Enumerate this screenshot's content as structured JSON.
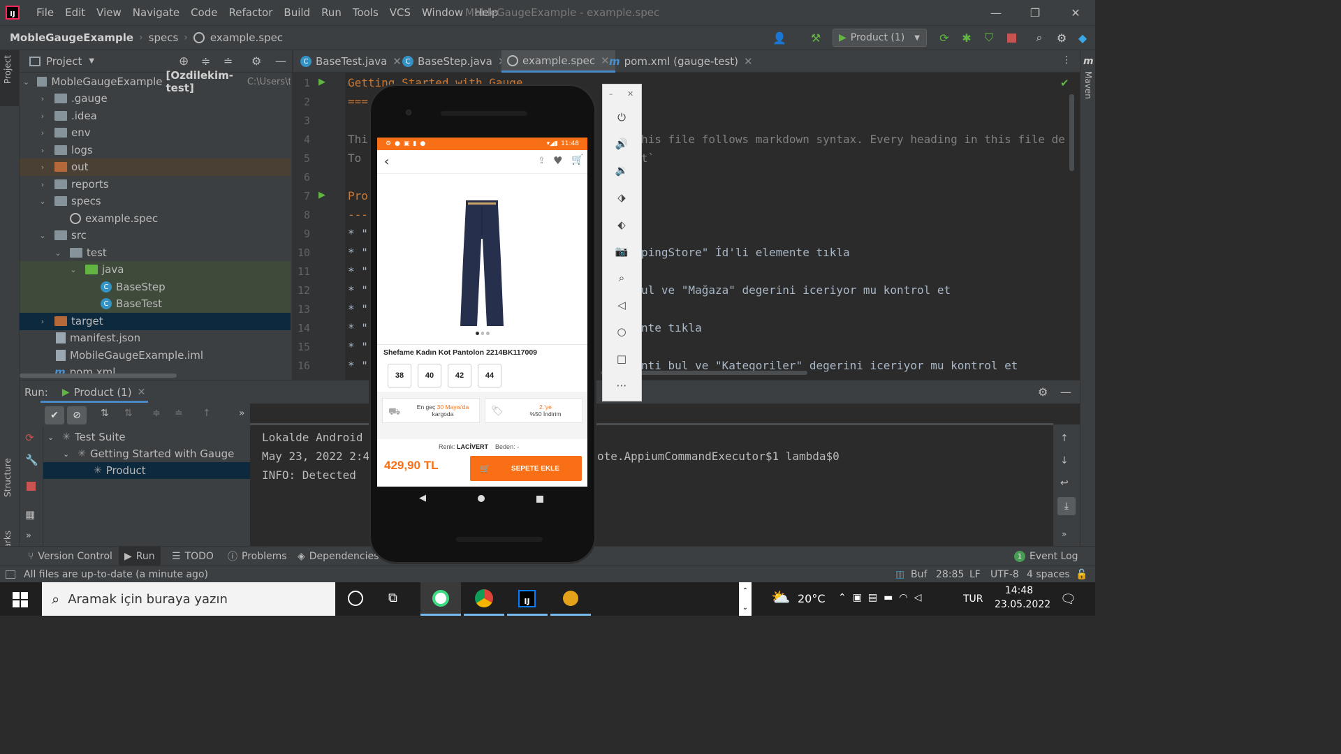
{
  "menubar": {
    "items": [
      "File",
      "Edit",
      "View",
      "Navigate",
      "Code",
      "Refactor",
      "Build",
      "Run",
      "Tools",
      "VCS",
      "Window",
      "Help"
    ],
    "title": "MobleGaugeExample - example.spec"
  },
  "navbar": {
    "project": "MobleGaugeExample",
    "crumb1": "specs",
    "crumb2": "example.spec",
    "run_config": "Product (1)"
  },
  "leftstripe": {
    "project": "Project",
    "structure": "Structure",
    "bookmarks": "Bookmarks"
  },
  "project_panel": {
    "title": "Project",
    "root": "MobleGaugeExample",
    "root_module": "[Ozdilekim-test]",
    "root_path": "C:\\Users\\tes",
    "items": [
      ".gauge",
      ".idea",
      "env",
      "logs",
      "out",
      "reports",
      "specs",
      "example.spec",
      "src",
      "test",
      "java",
      "BaseStep",
      "BaseTest",
      "target",
      "manifest.json",
      "MobileGaugeExample.iml",
      "pom.xml"
    ]
  },
  "editor": {
    "tabs": [
      "BaseTest.java",
      "BaseStep.java",
      "example.spec",
      "pom.xml (gauge-test)"
    ],
    "line_numbers": [
      "1",
      "2",
      "3",
      "4",
      "5",
      "6",
      "7",
      "8",
      "9",
      "10",
      "11",
      "12",
      "13",
      "14",
      "15",
      "16"
    ],
    "lines": {
      "l1": "Getting Started with Gauge",
      "l2": "===",
      "l4a": "Thi",
      "l4b": "his file follows markdown syntax. Every heading in this file de",
      "l5a": "To ",
      "l5b": "t`",
      "l7": "Pro",
      "l8": "---",
      "l9": "* \"",
      "l10a": "* \"",
      "l10b": "pingStore\" İd'li elemente tıkla",
      "l11": "* \"",
      "l12a": "* \"",
      "l12b": "ul ve \"Mağaza\" degerini iceriyor mu kontrol et",
      "l13": "* \"",
      "l14a": "* \"",
      "l14b": "nte tıkla",
      "l15": "* \"",
      "l16a": "* \"",
      "l16b": "nti bul ve \"Kategoriler\" degerini iceriyor mu kontrol et"
    }
  },
  "run_panel": {
    "label": "Run:",
    "tab": "Product (1)",
    "tree": [
      "Test Suite",
      "Getting Started with Gauge",
      "Product"
    ],
    "console": {
      "c1": "Lokalde Android ",
      "c2a": "May 23, 2022 2:4",
      "c2b": "ote.AppiumCommandExecutor$1 lambda$0",
      "c3": "INFO: Detected "
    }
  },
  "tooltabs": {
    "vc": "Version Control",
    "run": "Run",
    "todo": "TODO",
    "problems": "Problems",
    "deps": "Dependencies",
    "eventlog": "Event Log",
    "eventcount": "1"
  },
  "statusbar": {
    "message": "All files are up-to-date (a minute ago)",
    "buf": "Buf",
    "pos": "28:85",
    "lf": "LF",
    "enc": "UTF-8",
    "indent": "4 spaces"
  },
  "rightstripe": {
    "maven": "Maven"
  },
  "phone": {
    "status_time": "11:48",
    "product_title": "Shefame Kadın Kot Pantolon 2214BK117009",
    "sizes": [
      "38",
      "40",
      "42",
      "44"
    ],
    "ship_a": "En geç",
    "ship_date": "30 Mayıs'da",
    "ship_b": "kargoda",
    "promo_a": "2.'ye",
    "promo_b": "%50 İndirim",
    "color_label": "Renk:",
    "color_value": "LACİVERT",
    "size_label": "Beden:",
    "size_value": "-",
    "price": "429,90 TL",
    "cart_btn": "SEPETE EKLE",
    "accent": "#f96f15"
  },
  "taskbar": {
    "search": "Aramak için buraya yazın",
    "weather": "20°C",
    "lang": "TUR",
    "time": "14:48",
    "date": "23.05.2022"
  }
}
